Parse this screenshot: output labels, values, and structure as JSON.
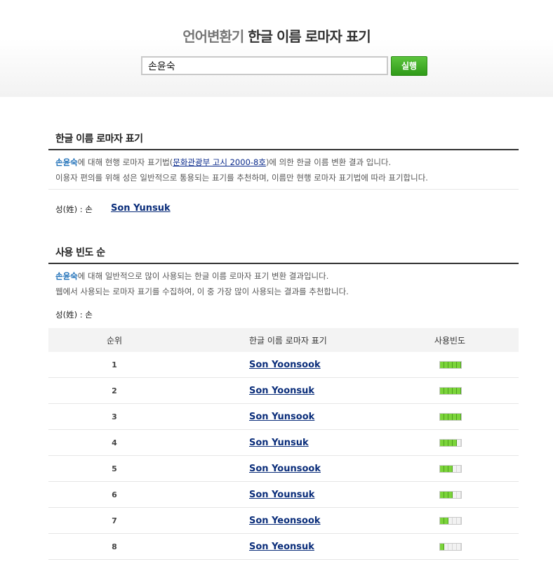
{
  "header": {
    "brand": "언어변환기",
    "title": "한글 이름 로마자 표기",
    "search_value": "손윤숙",
    "button_label": "실행"
  },
  "section1": {
    "title": "한글 이름 로마자 표기",
    "name": "손윤숙",
    "desc1_mid": "에 대해 현행 로마자 표기법(",
    "law_link": "문화관광부 고시 2000-8호",
    "desc1_end": ")에 의한 한글 이름 변환 결과 입니다.",
    "desc2": "이용자 편의를 위해 성은 일반적으로 통용되는 표기를 추천하며, 이름만 현행 로마자 표기법에 따라 표기합니다.",
    "surname_label": "성(姓) : 손",
    "result": "Son Yunsuk"
  },
  "section2": {
    "title": "사용 빈도 순",
    "name": "손윤숙",
    "desc1_end": "에 대해 일반적으로 많이 사용되는 한글 이름 로마자 표기 변환 결과입니다.",
    "desc2": "웹에서 사용되는 로마자 표기를 수집하여, 이 중 가장 많이 사용되는 결과를 추천합니다.",
    "surname_label": "성(姓) : 손"
  },
  "table": {
    "headers": [
      "순위",
      "한글 이름 로마자 표기",
      "사용빈도"
    ],
    "rows": [
      {
        "rank": "1",
        "name": "Son Yoonsook",
        "freq": 1.0
      },
      {
        "rank": "2",
        "name": "Son Yoonsuk",
        "freq": 1.0
      },
      {
        "rank": "3",
        "name": "Son Yunsook",
        "freq": 1.0
      },
      {
        "rank": "4",
        "name": "Son Yunsuk",
        "freq": 0.8
      },
      {
        "rank": "5",
        "name": "Son Younsook",
        "freq": 0.6
      },
      {
        "rank": "6",
        "name": "Son Younsuk",
        "freq": 0.6
      },
      {
        "rank": "7",
        "name": "Son Yeonsook",
        "freq": 0.4
      },
      {
        "rank": "8",
        "name": "Son Yeonsuk",
        "freq": 0.2
      }
    ]
  },
  "colors": {
    "accent_green": "#4caf24",
    "link_blue": "#0a2d7a",
    "highlight_blue": "#1d6fb8"
  }
}
